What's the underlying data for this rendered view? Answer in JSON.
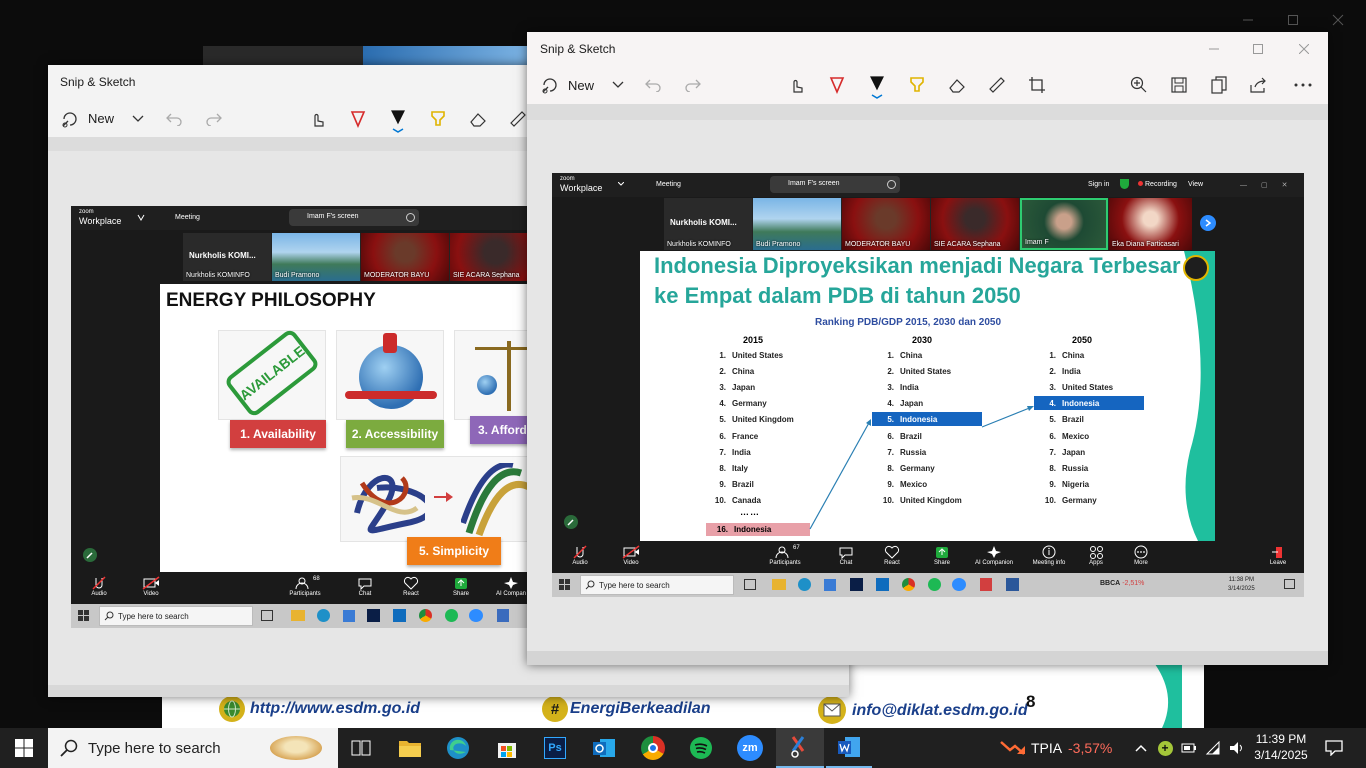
{
  "bg_slide": {
    "url": "http://www.esdm.go.id",
    "hashtag": "EnergiBerkeadilan",
    "email": "info@diklat.esdm.go.id",
    "page": "8"
  },
  "win_back": {
    "title": "Snip & Sketch",
    "new_label": "New",
    "zoom": {
      "brand_small": "zoom",
      "brand": "Workplace",
      "meeting": "Meeting",
      "screen_title": "Imam F's screen",
      "participants": [
        {
          "label": "Nurkholis  KOMI...",
          "name": "Nurkholis KOMINFO"
        },
        {
          "name": "Budi Pramono"
        },
        {
          "name": "MODERATOR BAYU"
        },
        {
          "name": "SIE ACARA  Sephana"
        }
      ],
      "slide": {
        "title": "ENERGY PHILOSOPHY",
        "items": [
          "1. Availability",
          "2. Accessibility",
          "3. Afford",
          "5. Simplicity"
        ],
        "stamp": "AVAILABLE"
      },
      "controls": {
        "audio": "Audio",
        "video": "Video",
        "participants_count": "68",
        "participants": "Participants",
        "chat": "Chat",
        "react": "React",
        "share": "Share",
        "ai": "AI Compan"
      },
      "search": "Type here to search"
    }
  },
  "win_front": {
    "title": "Snip & Sketch",
    "new_label": "New",
    "zoom": {
      "brand_small": "zoom",
      "brand": "Workplace",
      "meeting": "Meeting",
      "screen_title": "Imam F's screen",
      "sign_in": "Sign in",
      "recording": "Recording",
      "view": "View",
      "participants": [
        {
          "label": "Nurkholis  KOMI...",
          "name": "Nurkholis KOMINFO"
        },
        {
          "name": "Budi Pramono"
        },
        {
          "name": "MODERATOR BAYU"
        },
        {
          "name": "SIE ACARA  Sephana"
        },
        {
          "name": "Imam F"
        },
        {
          "name": "Eka Diana Farticasari"
        }
      ],
      "slide": {
        "title_line1": "Indonesia Diproyeksikan menjadi Negara Terbesar",
        "title_line2": "ke Empat  dalam PDB di tahun 2050",
        "subtitle": "Ranking PDB/GDP 2015, 2030 dan 2050",
        "col2015": {
          "year": "2015",
          "items": [
            {
              "n": "1.",
              "c": "United States"
            },
            {
              "n": "2.",
              "c": "China"
            },
            {
              "n": "3.",
              "c": "Japan"
            },
            {
              "n": "4.",
              "c": "Germany"
            },
            {
              "n": "5.",
              "c": "United Kingdom"
            },
            {
              "n": "6.",
              "c": "France"
            },
            {
              "n": "7.",
              "c": "India"
            },
            {
              "n": "8.",
              "c": "Italy"
            },
            {
              "n": "9.",
              "c": "Brazil"
            },
            {
              "n": "10.",
              "c": "Canada"
            }
          ],
          "dots": "……",
          "last": {
            "n": "16.",
            "c": "Indonesia"
          }
        },
        "col2030": {
          "year": "2030",
          "items": [
            {
              "n": "1.",
              "c": "China"
            },
            {
              "n": "2.",
              "c": "United States"
            },
            {
              "n": "3.",
              "c": "India"
            },
            {
              "n": "4.",
              "c": "Japan"
            },
            {
              "n": "5.",
              "c": "Indonesia"
            },
            {
              "n": "6.",
              "c": "Brazil"
            },
            {
              "n": "7.",
              "c": "Russia"
            },
            {
              "n": "8.",
              "c": "Germany"
            },
            {
              "n": "9.",
              "c": "Mexico"
            },
            {
              "n": "10.",
              "c": "United Kingdom"
            }
          ]
        },
        "col2050": {
          "year": "2050",
          "items": [
            {
              "n": "1.",
              "c": "China"
            },
            {
              "n": "2.",
              "c": "India"
            },
            {
              "n": "3.",
              "c": "United States"
            },
            {
              "n": "4.",
              "c": "Indonesia"
            },
            {
              "n": "5.",
              "c": "Brazil"
            },
            {
              "n": "6.",
              "c": "Mexico"
            },
            {
              "n": "7.",
              "c": "Japan"
            },
            {
              "n": "8.",
              "c": "Russia"
            },
            {
              "n": "9.",
              "c": "Nigeria"
            },
            {
              "n": "10.",
              "c": "Germany"
            }
          ]
        }
      },
      "controls": {
        "audio": "Audio",
        "video": "Video",
        "participants_count": "67",
        "participants": "Participants",
        "chat": "Chat",
        "react": "React",
        "share": "Share",
        "ai": "AI Companion",
        "meeting_info": "Meeting info",
        "apps": "Apps",
        "more": "More",
        "leave": "Leave"
      },
      "taskbar": {
        "search": "Type here to search",
        "stock": "BBCA",
        "change": "-2,51%",
        "time": "11:38 PM",
        "date": "3/14/2025"
      }
    }
  },
  "taskbar": {
    "search_placeholder": "Type here to search",
    "stock_symbol": "TPIA",
    "stock_change": "-3,57%",
    "time": "11:39 PM",
    "date": "3/14/2025"
  },
  "colors": {
    "accent": "#0078d4",
    "loss": "#ff6b5b",
    "highlight": "#1565c0",
    "slide_title": "#26a69a",
    "badge_red": "#d23f3f",
    "badge_green": "#7cab3f",
    "badge_purple": "#8e67b8",
    "badge_orange": "#f07d18"
  }
}
